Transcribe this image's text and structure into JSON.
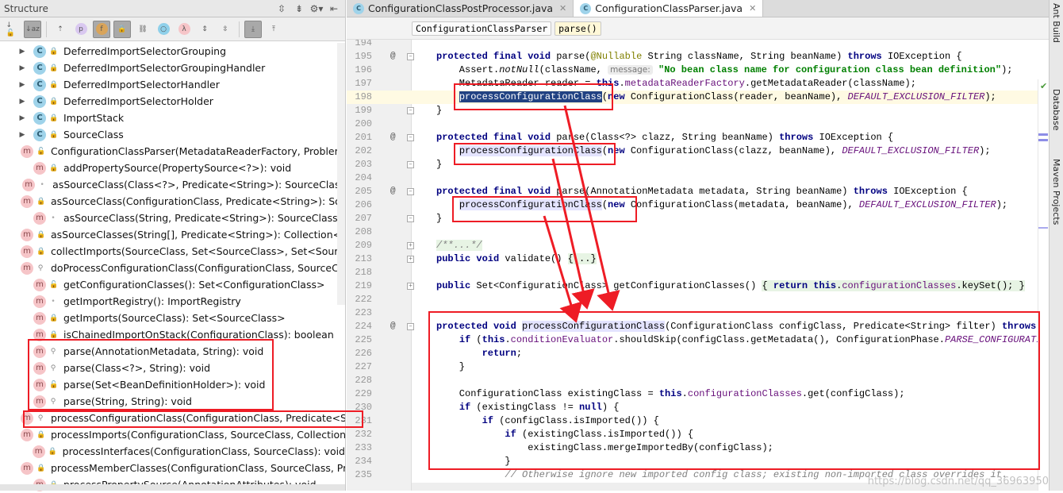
{
  "structure": {
    "title": "Structure",
    "header_icons": [
      "expand-all-icon",
      "collapse-all-icon",
      "gear-icon",
      "hide-icon"
    ],
    "toolbar": [
      {
        "icon": "sort-visibility-icon",
        "on": false,
        "g": "↓🔓"
      },
      {
        "icon": "sort-alpha-icon",
        "on": true,
        "g": "↓az"
      },
      {
        "sep": true
      },
      {
        "icon": "show-inherited-icon",
        "g": "⇡"
      },
      {
        "icon": "show-properties-icon",
        "g": "p",
        "c": "#d9c8f0"
      },
      {
        "icon": "show-fields-icon",
        "on": true,
        "g": "f",
        "c": "#d9a45a"
      },
      {
        "icon": "show-non-public-icon",
        "on": true,
        "g": "🔒"
      },
      {
        "icon": "show-anonymous-icon",
        "g": "⛓"
      },
      {
        "icon": "show-interfaces-icon",
        "g": "○",
        "c": "#8fd0ea"
      },
      {
        "icon": "show-lambdas-icon",
        "g": "λ",
        "c": "#f6c5c8"
      },
      {
        "icon": "expand-icon",
        "g": "⇕"
      },
      {
        "icon": "collapse-icon",
        "g": "⇳"
      },
      {
        "sep": true
      },
      {
        "icon": "autoscroll-to-source-icon",
        "on": true,
        "g": "⤓"
      },
      {
        "icon": "autoscroll-from-source-icon",
        "g": "⤒"
      }
    ],
    "items": [
      {
        "k": "c",
        "t": "DeferredImportSelectorGrouping",
        "tw": true,
        "v": "lock"
      },
      {
        "k": "c",
        "t": "DeferredImportSelectorGroupingHandler",
        "tw": true,
        "v": "lock"
      },
      {
        "k": "c",
        "t": "DeferredImportSelectorHandler",
        "tw": true,
        "v": "lock"
      },
      {
        "k": "c",
        "t": "DeferredImportSelectorHolder",
        "tw": true,
        "v": "lock"
      },
      {
        "k": "c",
        "t": "ImportStack",
        "tw": true,
        "v": "lock"
      },
      {
        "k": "c",
        "t": "SourceClass",
        "tw": true,
        "v": "lock"
      },
      {
        "k": "m",
        "t": "ConfigurationClassParser(MetadataReaderFactory, ProblemRe",
        "v": "public"
      },
      {
        "k": "m",
        "t": "addPropertySource(PropertySource<?>): void",
        "v": "lock"
      },
      {
        "k": "m",
        "t": "asSourceClass(Class<?>, Predicate<String>): SourceClass",
        "v": "package"
      },
      {
        "k": "m",
        "t": "asSourceClass(ConfigurationClass, Predicate<String>): Source",
        "v": "lock"
      },
      {
        "k": "m",
        "t": "asSourceClass(String, Predicate<String>): SourceClass",
        "v": "package"
      },
      {
        "k": "m",
        "t": "asSourceClasses(String[], Predicate<String>): Collection<Sour",
        "v": "lock"
      },
      {
        "k": "m",
        "t": "collectImports(SourceClass, Set<SourceClass>, Set<SourceCla",
        "v": "lock"
      },
      {
        "k": "m",
        "t": "doProcessConfigurationClass(ConfigurationClass, SourceClass",
        "v": "protected"
      },
      {
        "k": "m",
        "t": "getConfigurationClasses(): Set<ConfigurationClass>",
        "v": "public"
      },
      {
        "k": "m",
        "t": "getImportRegistry(): ImportRegistry",
        "v": "package"
      },
      {
        "k": "m",
        "t": "getImports(SourceClass): Set<SourceClass>",
        "v": "lock"
      },
      {
        "k": "m",
        "t": "isChainedImportOnStack(ConfigurationClass): boolean",
        "v": "lock"
      },
      {
        "k": "m",
        "t": "parse(AnnotationMetadata, String): void",
        "v": "protected"
      },
      {
        "k": "m",
        "t": "parse(Class<?>, String): void",
        "v": "protected"
      },
      {
        "k": "m",
        "t": "parse(Set<BeanDefinitionHolder>): void",
        "v": "public"
      },
      {
        "k": "m",
        "t": "parse(String, String): void",
        "v": "protected"
      },
      {
        "k": "m",
        "t": "processConfigurationClass(ConfigurationClass, Predicate<Stri",
        "v": "protected"
      },
      {
        "k": "m",
        "t": "processImports(ConfigurationClass, SourceClass, Collection<S",
        "v": "lock"
      },
      {
        "k": "m",
        "t": "processInterfaces(ConfigurationClass, SourceClass): void",
        "v": "lock"
      },
      {
        "k": "m",
        "t": "processMemberClasses(ConfigurationClass, SourceClass, Pred",
        "v": "lock"
      },
      {
        "k": "m",
        "t": "processPropertySource(AnnotationAttributes): void",
        "v": "lock"
      }
    ]
  },
  "tabs": [
    {
      "label": "ConfigurationClassPostProcessor.java",
      "active": false
    },
    {
      "label": "ConfigurationClassParser.java",
      "active": true
    }
  ],
  "breadcrumbs": [
    "ConfigurationClassParser",
    "parse()"
  ],
  "side_tools": [
    "Ant Build",
    "Database",
    "Maven Projects"
  ],
  "watermark": "https://blog.csdn.net/qq_36963950",
  "code": [
    {
      "n": "194",
      "t": []
    },
    {
      "n": "195",
      "m": "@",
      "f": "-",
      "t": [
        [
          "kw",
          "protected final void "
        ],
        [
          "",
          "parse("
        ],
        [
          "an",
          "@Nullable"
        ],
        [
          "",
          " String className, String beanName) "
        ],
        [
          "kw",
          "throws "
        ],
        [
          "",
          "IOException {"
        ]
      ]
    },
    {
      "n": "196",
      "t": [
        [
          "",
          "    Assert."
        ],
        [
          "it",
          "notNull"
        ],
        [
          "",
          "(className, "
        ],
        [
          "hint",
          "message:"
        ],
        [
          "",
          " "
        ],
        [
          "st",
          "\"No bean class name for configuration class bean definition\""
        ],
        [
          "",
          ");"
        ]
      ]
    },
    {
      "n": "197",
      "t": [
        [
          "",
          "    MetadataReader reader = "
        ],
        [
          "kw",
          "this"
        ],
        [
          "",
          "."
        ],
        [
          "fi",
          "metadataReaderFactory"
        ],
        [
          "",
          ".getMetadataReader(className);"
        ]
      ]
    },
    {
      "n": "198",
      "cur": true,
      "t": [
        [
          "",
          "    "
        ],
        [
          "sel",
          "processConfigurationClass"
        ],
        [
          "",
          "("
        ],
        [
          "kw",
          "new "
        ],
        [
          "",
          "ConfigurationClass(reader, beanName), "
        ],
        [
          "sti",
          "DEFAULT_EXCLUSION_FILTER"
        ],
        [
          "",
          ");"
        ]
      ]
    },
    {
      "n": "199",
      "f": "-",
      "t": [
        [
          "",
          "}"
        ]
      ]
    },
    {
      "n": "200",
      "t": []
    },
    {
      "n": "201",
      "m": "@",
      "f": "-",
      "t": [
        [
          "kw",
          "protected final void "
        ],
        [
          "",
          "parse(Class<?> clazz, String beanName) "
        ],
        [
          "kw",
          "throws "
        ],
        [
          "",
          "IOException {"
        ]
      ]
    },
    {
      "n": "202",
      "t": [
        [
          "",
          "    "
        ],
        [
          "us",
          "processConfigurationClass"
        ],
        [
          "",
          "("
        ],
        [
          "kw",
          "new "
        ],
        [
          "",
          "ConfigurationClass(clazz, beanName), "
        ],
        [
          "sti",
          "DEFAULT_EXCLUSION_FILTER"
        ],
        [
          "",
          ");"
        ]
      ]
    },
    {
      "n": "203",
      "f": "-",
      "t": [
        [
          "",
          "}"
        ]
      ]
    },
    {
      "n": "204",
      "t": []
    },
    {
      "n": "205",
      "m": "@",
      "f": "-",
      "t": [
        [
          "kw",
          "protected final void "
        ],
        [
          "",
          "parse(AnnotationMetadata metadata, String beanName) "
        ],
        [
          "kw",
          "throws "
        ],
        [
          "",
          "IOException {"
        ]
      ]
    },
    {
      "n": "206",
      "t": [
        [
          "",
          "    "
        ],
        [
          "us",
          "processConfigurationClass"
        ],
        [
          "",
          "("
        ],
        [
          "kw",
          "new "
        ],
        [
          "",
          "ConfigurationClass(metadata, beanName), "
        ],
        [
          "sti",
          "DEFAULT_EXCLUSION_FILTER"
        ],
        [
          "",
          ");"
        ]
      ]
    },
    {
      "n": "207",
      "f": "-",
      "t": [
        [
          "",
          "}"
        ]
      ]
    },
    {
      "n": "208",
      "t": []
    },
    {
      "n": "209",
      "f": "+",
      "t": [
        [
          "fo cm",
          "/**...*/"
        ]
      ]
    },
    {
      "n": "213",
      "f": "+",
      "t": [
        [
          "kw",
          "public void "
        ],
        [
          "",
          "validate() "
        ],
        [
          "fo",
          "{...}"
        ]
      ]
    },
    {
      "n": "218",
      "t": []
    },
    {
      "n": "219",
      "f": "+",
      "t": [
        [
          "kw",
          "public "
        ],
        [
          "",
          "Set<ConfigurationClass> getConfigurationClasses() "
        ],
        [
          "fo",
          "{ "
        ],
        [
          "fo kw",
          "return this"
        ],
        [
          "fo",
          "."
        ],
        [
          "fo fi",
          "configurationClasses"
        ],
        [
          "fo",
          ".keySet(); }"
        ]
      ]
    },
    {
      "n": "222",
      "t": []
    },
    {
      "n": "223",
      "t": []
    },
    {
      "n": "224",
      "m": "@",
      "f": "-",
      "t": [
        [
          "kw",
          "protected void "
        ],
        [
          "us",
          "processConfigurationClass"
        ],
        [
          "",
          "(ConfigurationClass configClass, Predicate<String> filter) "
        ],
        [
          "kw",
          "throws "
        ],
        [
          "",
          "IOEx"
        ]
      ]
    },
    {
      "n": "225",
      "t": [
        [
          "",
          "    "
        ],
        [
          "kw",
          "if "
        ],
        [
          "",
          "("
        ],
        [
          "kw",
          "this"
        ],
        [
          "",
          "."
        ],
        [
          "fi",
          "conditionEvaluator"
        ],
        [
          "",
          ".shouldSkip(configClass.getMetadata(), ConfigurationPhase."
        ],
        [
          "sti",
          "PARSE_CONFIGURATION"
        ],
        [
          "",
          ")) {"
        ]
      ]
    },
    {
      "n": "226",
      "t": [
        [
          "",
          "        "
        ],
        [
          "kw",
          "return"
        ],
        [
          "",
          ";"
        ]
      ]
    },
    {
      "n": "227",
      "t": [
        [
          "",
          "    }"
        ]
      ]
    },
    {
      "n": "228",
      "t": []
    },
    {
      "n": "229",
      "t": [
        [
          "",
          "    ConfigurationClass existingClass = "
        ],
        [
          "kw",
          "this"
        ],
        [
          "",
          "."
        ],
        [
          "fi",
          "configurationClasses"
        ],
        [
          "",
          ".get(configClass);"
        ]
      ]
    },
    {
      "n": "230",
      "t": [
        [
          "",
          "    "
        ],
        [
          "kw",
          "if "
        ],
        [
          "",
          "(existingClass != "
        ],
        [
          "kw",
          "null"
        ],
        [
          "",
          ") {"
        ]
      ]
    },
    {
      "n": "231",
      "t": [
        [
          "",
          "        "
        ],
        [
          "kw",
          "if "
        ],
        [
          "",
          "(configClass.isImported()) {"
        ]
      ]
    },
    {
      "n": "232",
      "t": [
        [
          "",
          "            "
        ],
        [
          "kw",
          "if "
        ],
        [
          "",
          "(existingClass.isImported()) {"
        ]
      ]
    },
    {
      "n": "233",
      "t": [
        [
          "",
          "                existingClass.mergeImportedBy(configClass);"
        ]
      ]
    },
    {
      "n": "234",
      "t": [
        [
          "",
          "            }"
        ]
      ]
    },
    {
      "n": "235",
      "t": [
        [
          "",
          "            "
        ],
        [
          "cm",
          "// Otherwise ignore new imported config class; existing non-imported class overrides it."
        ]
      ]
    }
  ],
  "annotation_color": "#ee1c25"
}
